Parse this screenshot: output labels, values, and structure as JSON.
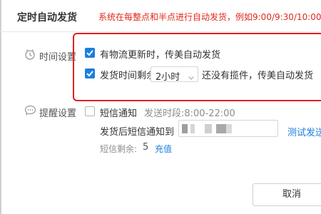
{
  "dialog": {
    "title": "定时自动发货",
    "notice": "系统在每整点和半点进行自动发货，例如9:00/9:30/10:00"
  },
  "time_settings": {
    "label": "时间设置",
    "option1_label": "有物流更新时，传美自动发货",
    "option2_prefix": "发货时间剩余",
    "duration_selected": "2小时",
    "option2_suffix": "还没有揽件，传美自动发货"
  },
  "reminder": {
    "label": "提醒设置",
    "sms_checkbox_label": "短信通知",
    "sms_period": "发送时段:8:00-22:00",
    "notify_after_label": "发货后短信通知到",
    "test_send_link": "测试发送",
    "sms_remaining_label": "短信剩余:",
    "sms_remaining_count": "5",
    "recharge_link": "充值"
  },
  "footer": {
    "cancel_label": "取消"
  },
  "colors": {
    "accent": "#1a7fe0",
    "notice_red": "#e0281b",
    "highlight_box": "#e02020"
  },
  "icons": {
    "time_icon": "clock-icon",
    "reminder_icon": "chat-bubble-icon",
    "checkbox_icon": "checkmark-icon",
    "select_icon": "chevron-down-icon"
  }
}
